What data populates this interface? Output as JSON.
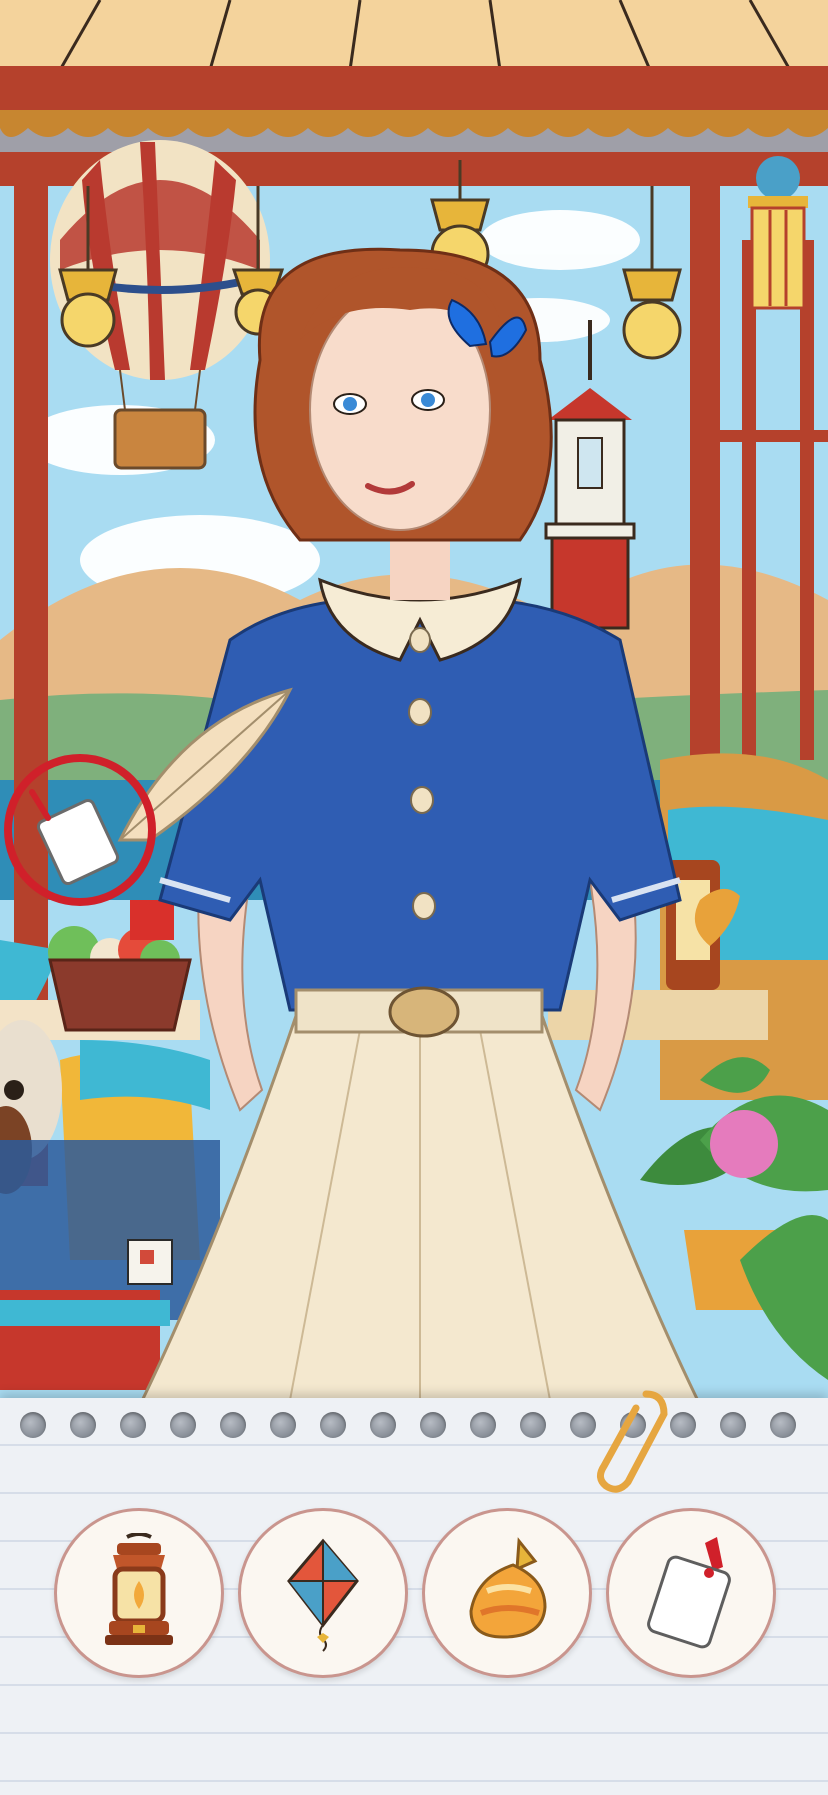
{
  "game": {
    "mode": "find-the-hidden-objects"
  },
  "scene": {
    "found_marker": {
      "item": "luggage-tag",
      "marker_color": "#d0202a"
    }
  },
  "tray": {
    "items": [
      {
        "name": "lantern",
        "icon": "lantern-icon",
        "found": false
      },
      {
        "name": "kite",
        "icon": "kite-icon",
        "found": false
      },
      {
        "name": "candy",
        "icon": "candy-icon",
        "found": false
      },
      {
        "name": "luggage-tag",
        "icon": "tag-icon",
        "found": true
      }
    ]
  },
  "colors": {
    "blouse": "#2f5db3",
    "skirt": "#f4e8cf",
    "hair": "#b0552b",
    "frame": "#b5412c",
    "sky": "#a9dcf2",
    "tray_border": "#c9958e"
  }
}
